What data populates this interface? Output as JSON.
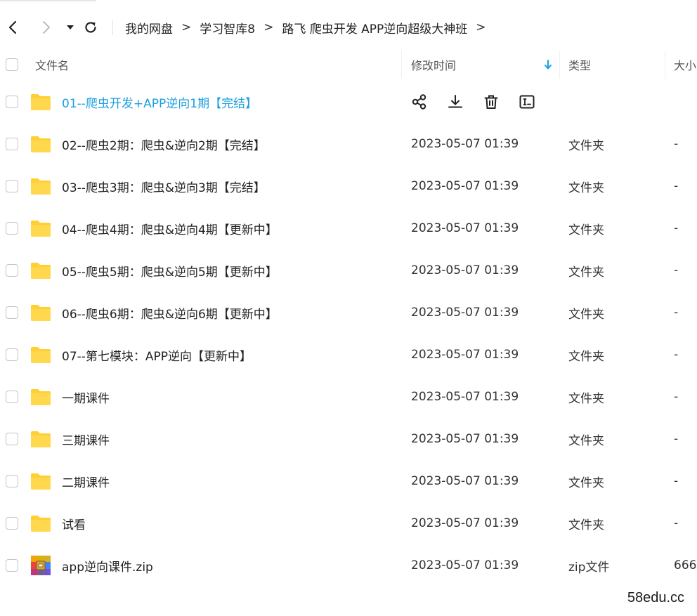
{
  "breadcrumb": {
    "items": [
      "我的网盘",
      "学习智库8",
      "路飞 爬虫开发 APP逆向超级大神班"
    ],
    "separator": ">"
  },
  "columns": {
    "name": "文件名",
    "modified": "修改时间",
    "type": "类型",
    "size": "大小"
  },
  "files": [
    {
      "name": "01--爬虫开发+APP逆向1期【完结】",
      "time": "",
      "type": "",
      "size": "",
      "icon": "folder-icon"
    },
    {
      "name": "02--爬虫2期：爬虫&逆向2期【完结】",
      "time": "2023-05-07 01:39",
      "type": "文件夹",
      "size": "-",
      "icon": "folder-icon"
    },
    {
      "name": "03--爬虫3期：爬虫&逆向3期【完结】",
      "time": "2023-05-07 01:39",
      "type": "文件夹",
      "size": "-",
      "icon": "folder-icon"
    },
    {
      "name": "04--爬虫4期：爬虫&逆向4期【更新中】",
      "time": "2023-05-07 01:39",
      "type": "文件夹",
      "size": "-",
      "icon": "folder-icon"
    },
    {
      "name": "05--爬虫5期：爬虫&逆向5期【更新中】",
      "time": "2023-05-07 01:39",
      "type": "文件夹",
      "size": "-",
      "icon": "folder-icon"
    },
    {
      "name": "06--爬虫6期：爬虫&逆向6期【更新中】",
      "time": "2023-05-07 01:39",
      "type": "文件夹",
      "size": "-",
      "icon": "folder-icon"
    },
    {
      "name": "07--第七模块：APP逆向【更新中】",
      "time": "2023-05-07 01:39",
      "type": "文件夹",
      "size": "-",
      "icon": "folder-icon"
    },
    {
      "name": "一期课件",
      "time": "2023-05-07 01:39",
      "type": "文件夹",
      "size": "-",
      "icon": "folder-icon"
    },
    {
      "name": "三期课件",
      "time": "2023-05-07 01:39",
      "type": "文件夹",
      "size": "-",
      "icon": "folder-icon"
    },
    {
      "name": "二期课件",
      "time": "2023-05-07 01:39",
      "type": "文件夹",
      "size": "-",
      "icon": "folder-icon"
    },
    {
      "name": "试看",
      "time": "2023-05-07 01:39",
      "type": "文件夹",
      "size": "-",
      "icon": "folder-icon"
    },
    {
      "name": "app逆向课件.zip",
      "time": "2023-05-07 01:39",
      "type": "zip文件",
      "size": "666",
      "icon": "zip-file-icon"
    }
  ],
  "watermark": "58edu.cc",
  "colors": {
    "accent": "#1b9fe0",
    "folder": "#ffcf33",
    "text": "#222222"
  }
}
